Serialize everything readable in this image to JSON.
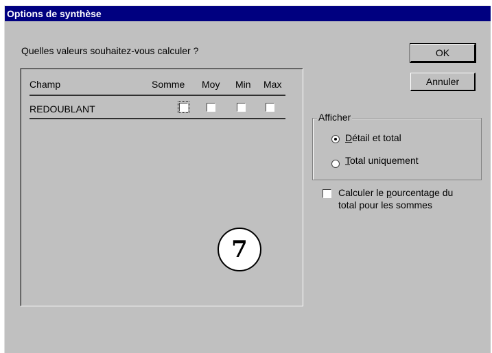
{
  "window": {
    "title": "Options de synthèse"
  },
  "prompt": "Quelles valeurs souhaitez-vous calculer ?",
  "table": {
    "headers": {
      "champ": "Champ",
      "somme": "Somme",
      "moy": "Moy",
      "min": "Min",
      "max": "Max"
    },
    "rows": [
      {
        "field": "REDOUBLANT",
        "somme": false,
        "moy": false,
        "min": false,
        "max": false
      }
    ]
  },
  "buttons": {
    "ok": "OK",
    "annuler": "Annuler"
  },
  "afficher": {
    "label": "Afficher",
    "options": [
      {
        "mnemonic": "D",
        "rest": "étail et total",
        "selected": true
      },
      {
        "mnemonic": "T",
        "rest": "otal uniquement",
        "selected": false
      }
    ]
  },
  "percentage": {
    "line1_before": "Calculer le ",
    "line1_mnemonic": "p",
    "line1_after": "ourcentage du",
    "line2": "total pour les sommes",
    "checked": false
  },
  "annotation": {
    "number": "7"
  },
  "colors": {
    "title_bar": "#000080",
    "dialog_bg": "#c0c0c0"
  }
}
